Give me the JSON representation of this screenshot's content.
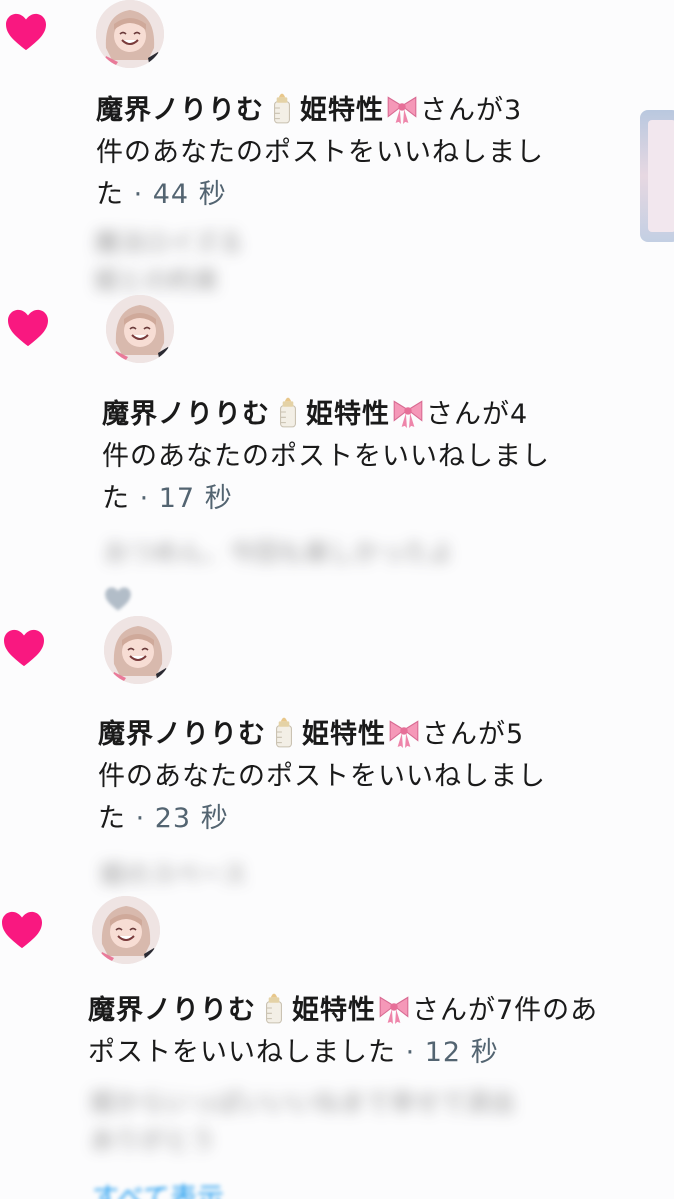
{
  "notifications": [
    {
      "name": "魔界ノりりむ",
      "name_suffix": "姫特性",
      "line1_tail": "さんが3",
      "line2": "件のあなたのポストをいいねしまし",
      "line3": "た",
      "time": "· 44 秒",
      "preview_line1": "魔法ロイズる",
      "preview_line2": "姫との約束",
      "icons": {
        "like": "heart-icon",
        "bottle": "baby-bottle-icon",
        "ribbon": "ribbon-icon"
      }
    },
    {
      "name": "魔界ノりりむ",
      "name_suffix": "姫特性",
      "line1_tail": "さんが4",
      "line2": "件のあなたのポストをいいねしまし",
      "line3": "た",
      "time": "· 17 秒",
      "preview_line1": "おつめん、今回も楽しかったよ",
      "preview_line2": "",
      "icons": {
        "like": "heart-icon",
        "bottle": "baby-bottle-icon",
        "ribbon": "ribbon-icon"
      }
    },
    {
      "name": "魔界ノりりむ",
      "name_suffix": "姫特性",
      "line1_tail": "さんが5",
      "line2": "件のあなたのポストをいいねしまし",
      "line3": "た",
      "time": "· 23 秒",
      "preview_line1": "姫のスペース",
      "preview_line2": "",
      "icons": {
        "like": "heart-icon",
        "bottle": "baby-bottle-icon",
        "ribbon": "ribbon-icon"
      }
    },
    {
      "name": "魔界ノりりむ",
      "name_suffix": "姫特性",
      "line1_tail": "さんが7件のあ",
      "line2": "ポストをいいねしました",
      "line3": "",
      "time": "· 12 秒",
      "preview_line1": "姫からいっぱいいいねまで幸せで涙出",
      "preview_line2": "ありがとう",
      "icons": {
        "like": "heart-icon",
        "bottle": "baby-bottle-icon",
        "ribbon": "ribbon-icon"
      }
    }
  ],
  "footer": {
    "show_all": "すべて表示"
  },
  "colors": {
    "like_pink": "#f91880",
    "time_gray": "#536471",
    "link_blue": "#1d9bf0"
  }
}
